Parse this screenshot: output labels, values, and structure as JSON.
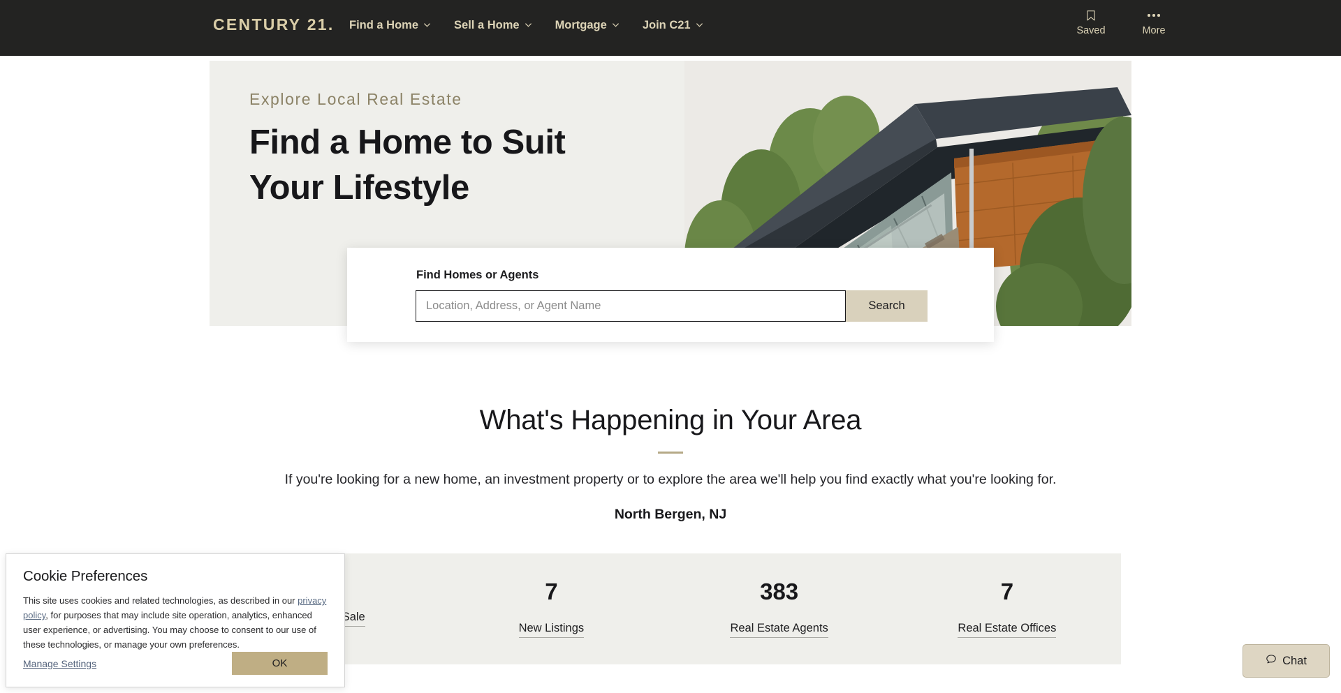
{
  "header": {
    "logo": "CENTURY 21.",
    "nav": [
      {
        "label": "Find a Home",
        "icon": "chevron-down-icon"
      },
      {
        "label": "Sell a Home",
        "icon": "chevron-down-icon"
      },
      {
        "label": "Mortgage",
        "icon": "chevron-down-icon"
      },
      {
        "label": "Join C21",
        "icon": "chevron-down-icon"
      }
    ],
    "saved": {
      "label": "Saved",
      "icon": "bookmark-icon"
    },
    "more": {
      "label": "More",
      "icon": "ellipsis-icon"
    },
    "bg_color": "#232322",
    "text_color": "#dcd3b6"
  },
  "hero": {
    "eyebrow": "Explore Local Real Estate",
    "title_line1": "Find a Home to Suit",
    "title_line2": "Your Lifestyle",
    "bg_color": "#efefeb",
    "photo_alt": "modern house with dark flat roof, wood siding and stone base surrounded by trees"
  },
  "search": {
    "label": "Find Homes or Agents",
    "placeholder": "Location, Address, or Agent Name",
    "value": "",
    "button_label": "Search",
    "button_color": "#d9d1bc"
  },
  "area": {
    "title": "What's Happening in Your Area",
    "subtitle": "If you're looking for a new home, an investment property or to explore the area we'll help you find exactly what you're looking for.",
    "location": "North Bergen, NJ",
    "rule_color": "#b5a987"
  },
  "stats": [
    {
      "value": "",
      "label": "Homes For Sale"
    },
    {
      "value": "7",
      "label": "New Listings"
    },
    {
      "value": "383",
      "label": "Real Estate Agents"
    },
    {
      "value": "7",
      "label": "Real Estate Offices"
    }
  ],
  "cookie": {
    "title": "Cookie Preferences",
    "body_part1": "This site uses cookies and related technologies, as described in our ",
    "link_text": "privacy policy",
    "body_part2": ", for purposes that may include site operation, analytics, enhanced user experience, or advertising. You may choose to consent to our use of these technologies, or manage your own preferences.",
    "manage_label": "Manage Settings",
    "ok_label": "OK",
    "ok_color": "#bfae84"
  },
  "chat": {
    "label": "Chat",
    "icon": "chat-bubble-icon",
    "bg_color": "#ded6c3"
  }
}
